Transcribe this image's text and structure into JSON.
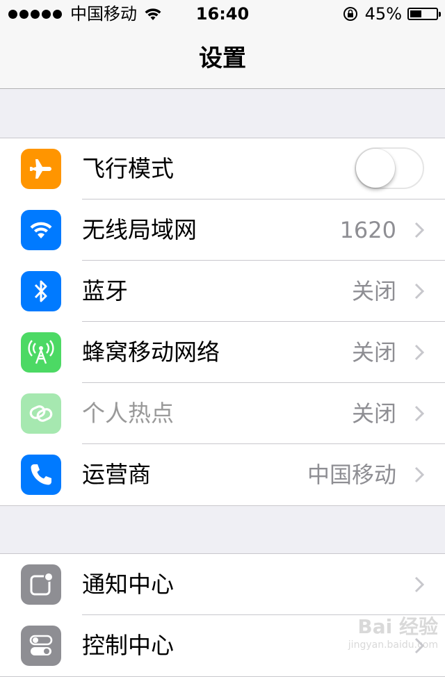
{
  "status_bar": {
    "carrier": "中国移动",
    "time": "16:40",
    "battery": "45%",
    "battery_level": 0.45,
    "icons": [
      "signal-dots",
      "wifi-icon",
      "rotation-lock-icon",
      "battery-icon"
    ]
  },
  "nav": {
    "title": "设置"
  },
  "groups": [
    {
      "rows": [
        {
          "label": "飞行模式",
          "icon": "airplane-icon",
          "color": "#ff9500",
          "toggle": false
        },
        {
          "label": "无线局域网",
          "icon": "wifi-icon",
          "color": "#007aff",
          "value": "1620"
        },
        {
          "label": "蓝牙",
          "icon": "bluetooth-icon",
          "color": "#007aff",
          "value": "关闭"
        },
        {
          "label": "蜂窝移动网络",
          "icon": "cellular-antenna-icon",
          "color": "#4cd964",
          "value": "关闭"
        },
        {
          "label": "个人热点",
          "icon": "hotspot-link-icon",
          "color": "#a6e8b0",
          "value": "关闭",
          "disabled": true
        },
        {
          "label": "运营商",
          "icon": "phone-icon",
          "color": "#007aff",
          "value": "中国移动"
        }
      ]
    },
    {
      "rows": [
        {
          "label": "通知中心",
          "icon": "notification-center-icon",
          "color": "#8e8e93"
        },
        {
          "label": "控制中心",
          "icon": "control-center-icon",
          "color": "#8e8e93"
        }
      ]
    }
  ],
  "watermark": {
    "brand": "Bai 经验",
    "url": "jingyan.baidu.com"
  }
}
